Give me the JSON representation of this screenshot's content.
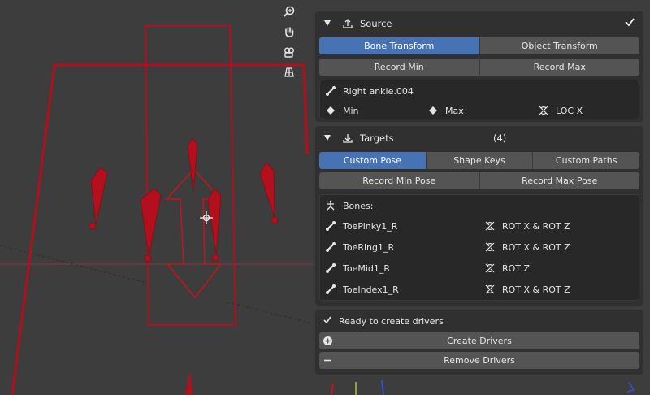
{
  "viewport": {
    "tools": [
      {
        "icon": "zoom-icon"
      },
      {
        "icon": "hand-pan-icon"
      },
      {
        "icon": "camera-icon"
      },
      {
        "icon": "perspective-grid-icon"
      }
    ],
    "colors": {
      "rig": "#b30f1c",
      "rig_light": "#c8141e",
      "background": "#3d3d3d"
    }
  },
  "source": {
    "title": "Source",
    "icon": "upload-icon",
    "mode_tabs": [
      "Bone Transform",
      "Object Transform"
    ],
    "active_mode": 0,
    "record_buttons": [
      "Record Min",
      "Record Max"
    ],
    "bone_name": "Right ankle.004",
    "min_label": "Min",
    "max_label": "Max",
    "channel": "LOC X"
  },
  "targets": {
    "title": "Targets",
    "icon": "download-icon",
    "count": "(4)",
    "tabs": [
      "Custom Pose",
      "Shape Keys",
      "Custom Paths"
    ],
    "active_tab": 0,
    "record_buttons": [
      "Record Min Pose",
      "Record Max Pose"
    ],
    "bones_label": "Bones:",
    "bones": [
      {
        "name": "ToePinky1_R",
        "channels": "ROT X & ROT Z"
      },
      {
        "name": "ToeRing1_R",
        "channels": "ROT X & ROT Z"
      },
      {
        "name": "ToeMid1_R",
        "channels": "ROT Z"
      },
      {
        "name": "ToeIndex1_R",
        "channels": "ROT X & ROT Z"
      }
    ]
  },
  "status": {
    "text": "Ready to create drivers",
    "create_label": "Create Drivers",
    "remove_label": "Remove Drivers"
  },
  "colors": {
    "accent": "#4772b3",
    "panel_bg": "#303030",
    "box_bg": "#282828",
    "button_bg": "#545454",
    "text": "#e6e6e6"
  }
}
